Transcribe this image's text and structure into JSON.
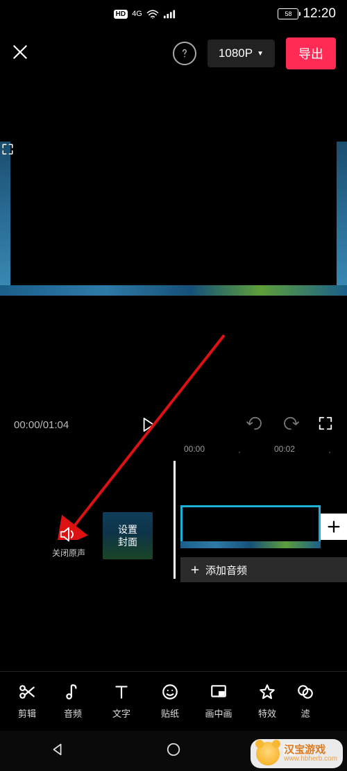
{
  "status": {
    "hd": "HD",
    "net": "4G",
    "battery": "58",
    "time": "12:20"
  },
  "topbar": {
    "resolution": "1080P",
    "export": "导出"
  },
  "playback": {
    "time": "00:00/01:04"
  },
  "ruler": {
    "t0": "00:00",
    "t1": "00:02"
  },
  "timeline": {
    "mute_label": "关闭原声",
    "cover_label_1": "设置",
    "cover_label_2": "封面",
    "add_audio": "添加音频"
  },
  "tools": {
    "edit": "剪辑",
    "audio": "音频",
    "text": "文字",
    "sticker": "贴纸",
    "pip": "画中画",
    "fx": "特效",
    "filter": "滤"
  },
  "watermark": {
    "name": "汉宝游戏",
    "url": "www.hbherb.com"
  }
}
